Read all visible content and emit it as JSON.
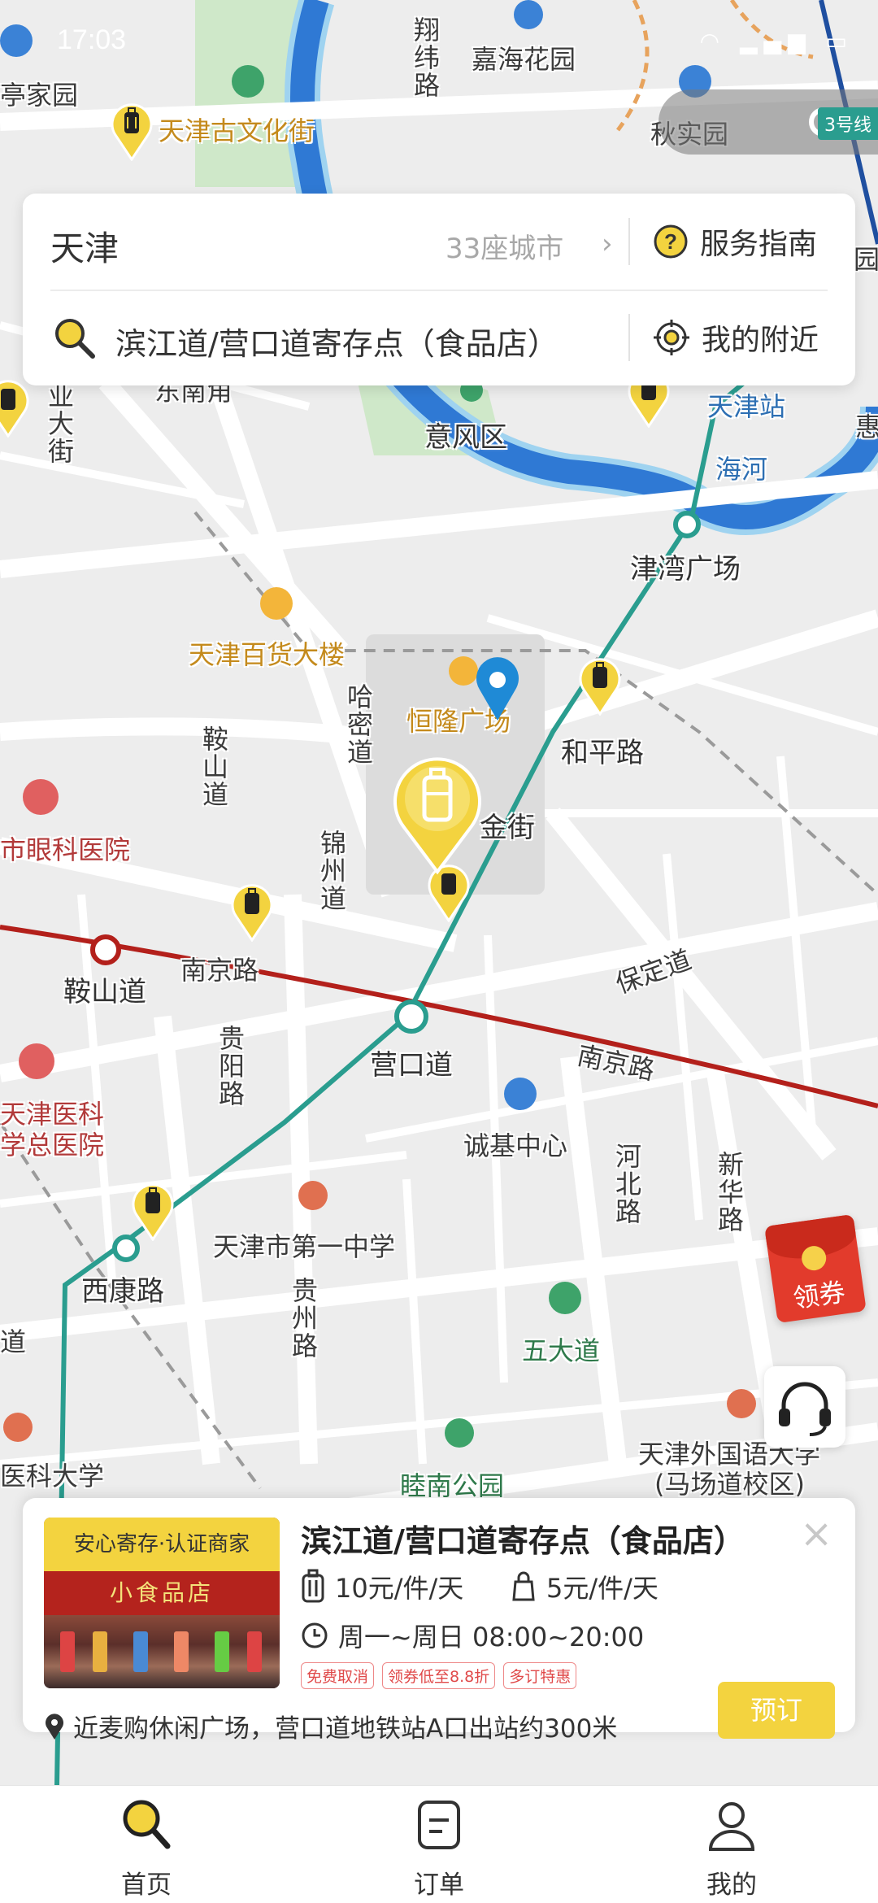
{
  "status_bar": {
    "time": "17:03"
  },
  "map": {
    "labels": {
      "l1": "亭家园",
      "l2": "天津古文化街",
      "l3": "翔纬路",
      "l4": "嘉海花园",
      "l5": "秋实园",
      "l6": "东南角",
      "l7": "业大街",
      "l8": "意风区",
      "l9": "天津站",
      "l10": "海河",
      "l11": "津湾广场",
      "l12": "天津百货大楼",
      "l13": "恒隆广场",
      "l14": "和平路",
      "l15": "哈密道",
      "l16": "鞍山道",
      "l17": "金街",
      "l18": "市眼科医院",
      "l19": "锦州道",
      "l20": "鞍山道",
      "l21": "南京路",
      "l22": "保定道",
      "l23": "营口道",
      "l24": "南京路",
      "l25": "贵阳路",
      "l26": "天津医科",
      "l27": "学总医院",
      "l28": "诚基中心",
      "l29": "河北路",
      "l30": "新华路",
      "l31": "西康路",
      "l32": "天津市第一中学",
      "l33": "贵州路",
      "l34": "五大道",
      "l35": "医科大学",
      "l36": "睦南公园",
      "l37": "天津外国语大学",
      "l38": "(马场道校区)",
      "l39": "3号线",
      "l40": "道",
      "l41": "园",
      "l42": "惠"
    }
  },
  "search": {
    "city": "天津",
    "city_count": "33座城市",
    "guide_label": "服务指南",
    "query": "滨江道/营口道寄存点（食品店）",
    "nearby_label": "我的附近"
  },
  "coupon_label": "领券",
  "store": {
    "badge": "安心寄存·认证商家",
    "sign_text": "小食品店",
    "name": "滨江道/营口道寄存点（食品店）",
    "price_large": "10元/件/天",
    "price_small": "5元/件/天",
    "hours": "周一~周日 08:00~20:00",
    "tags": [
      "免费取消",
      "领券低至8.8折",
      "多订特惠"
    ],
    "address": "近麦购休闲广场，营口道地铁站A口出站约300米",
    "book_label": "预订"
  },
  "nav": {
    "home": "首页",
    "orders": "订单",
    "mine": "我的"
  },
  "colors": {
    "accent": "#f3d33f",
    "metro_red": "#b3201b",
    "metro_teal": "#2a9d8f",
    "river": "#2f79d4"
  }
}
